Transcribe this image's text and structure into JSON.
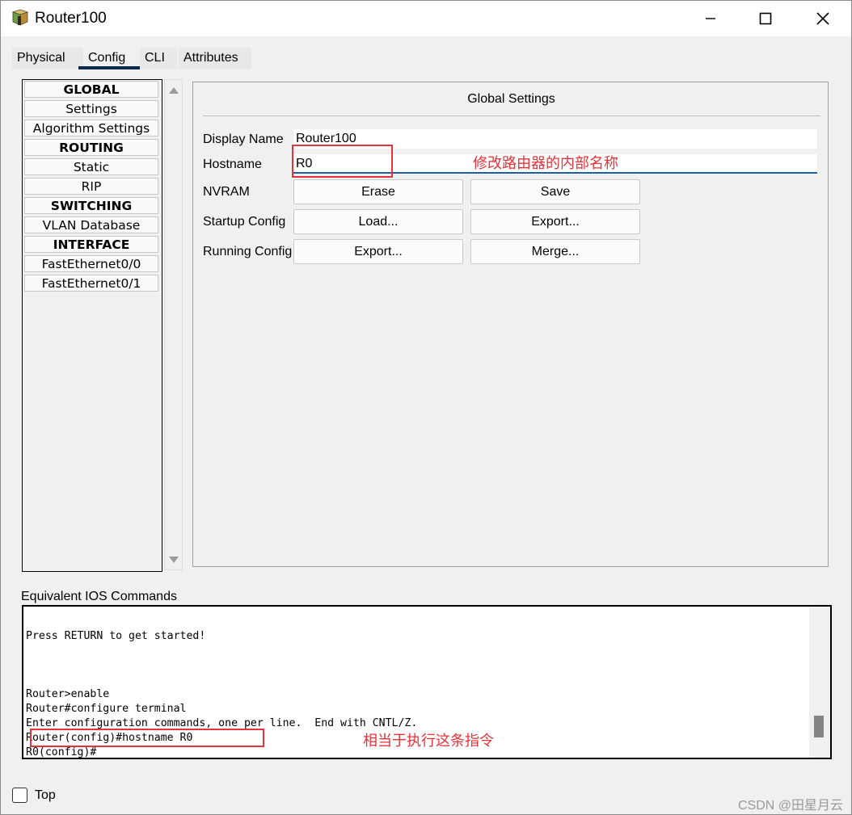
{
  "window": {
    "title": "Router100"
  },
  "tabs": [
    {
      "label": "Physical"
    },
    {
      "label": "Config"
    },
    {
      "label": "CLI"
    },
    {
      "label": "Attributes"
    }
  ],
  "active_tab": "Config",
  "sidebar": {
    "items": [
      {
        "label": "GLOBAL",
        "header": true
      },
      {
        "label": "Settings",
        "header": false
      },
      {
        "label": "Algorithm Settings",
        "header": false
      },
      {
        "label": "ROUTING",
        "header": true
      },
      {
        "label": "Static",
        "header": false
      },
      {
        "label": "RIP",
        "header": false
      },
      {
        "label": "SWITCHING",
        "header": true
      },
      {
        "label": "VLAN Database",
        "header": false
      },
      {
        "label": "INTERFACE",
        "header": true
      },
      {
        "label": "FastEthernet0/0",
        "header": false
      },
      {
        "label": "FastEthernet0/1",
        "header": false
      }
    ]
  },
  "global_settings": {
    "title": "Global Settings",
    "display_name_label": "Display Name",
    "display_name_value": "Router100",
    "hostname_label": "Hostname",
    "hostname_value": "R0",
    "nvram_label": "NVRAM",
    "startup_config_label": "Startup Config",
    "running_config_label": "Running Config",
    "buttons": {
      "erase": "Erase",
      "save": "Save",
      "load": "Load...",
      "export_startup": "Export...",
      "export_running": "Export...",
      "merge": "Merge..."
    }
  },
  "annotations": {
    "hostname_note": "修改路由器的内部名称",
    "command_note": "相当于执行这条指令",
    "color": "#e5333a"
  },
  "ios": {
    "label": "Equivalent IOS Commands",
    "lines": [
      "Press RETURN to get started!",
      "Router>enable",
      "Router#configure terminal",
      "Enter configuration commands, one per line.  End with CNTL/Z.",
      "Router(config)#hostname R0",
      "R0(config)#"
    ]
  },
  "footer": {
    "top_label": "Top",
    "top_checked": false,
    "watermark": "CSDN @田星月云"
  },
  "colors": {
    "tab_underline": "#0b2a4a",
    "hostname_focus": "#1f5fa8"
  }
}
